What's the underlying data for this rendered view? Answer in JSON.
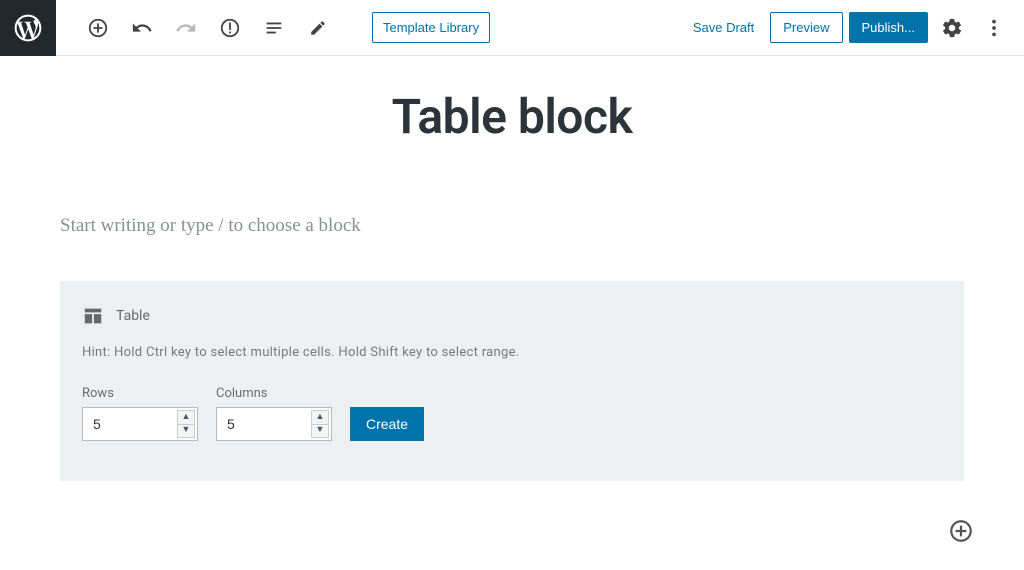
{
  "toolbar": {
    "template_library_label": "Template Library",
    "save_draft_label": "Save Draft",
    "preview_label": "Preview",
    "publish_label": "Publish..."
  },
  "page": {
    "title": "Table block",
    "placeholder": "Start writing or type / to choose a block"
  },
  "table_block": {
    "name_label": "Table",
    "hint": "Hint: Hold Ctrl key to select multiple cells. Hold Shift key to select range.",
    "rows_label": "Rows",
    "rows_value": "5",
    "columns_label": "Columns",
    "columns_value": "5",
    "create_label": "Create"
  },
  "colors": {
    "accent": "#0073aa"
  }
}
